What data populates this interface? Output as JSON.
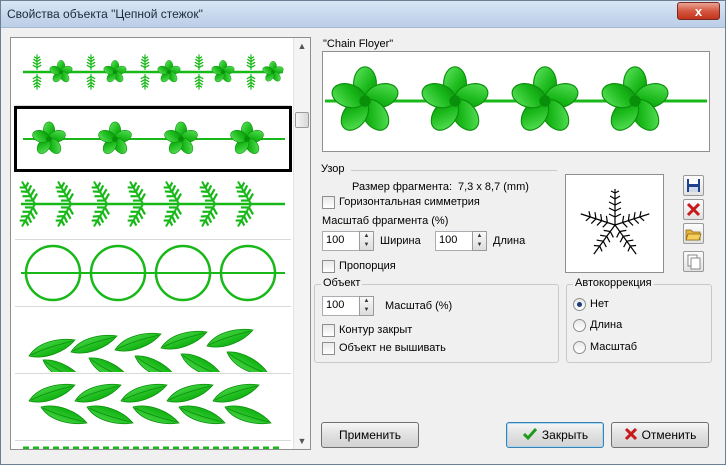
{
  "window": {
    "title": "Свойства объекта \"Цепной стежок\"",
    "close_label": "x"
  },
  "gallery": {
    "items": [
      "leaf-flower-chain",
      "flower-chain",
      "fern-chain",
      "ring-chain",
      "leaf-braid",
      "leaf-braid-2",
      "dots"
    ],
    "selected_index": 1
  },
  "preview": {
    "label": "\"Chain Floyer\""
  },
  "pattern": {
    "label": "Узор",
    "fragment_size_label": "Размер фрагмента:",
    "fragment_size_value": "7,3 x 8,7 (mm)",
    "h_symmetry_label": "Горизонтальная симметрия",
    "scale_label": "Масштаб фрагмента (%)",
    "width_value": "100",
    "width_label": "Ширина",
    "length_value": "100",
    "length_label": "Длина",
    "proportion_label": "Пропорция"
  },
  "object": {
    "label": "Объект",
    "scale_value": "100",
    "scale_label": "Масштаб (%)",
    "contour_closed_label": "Контур закрыт",
    "no_embroider_label": "Объект не вышивать"
  },
  "autocorrection": {
    "label": "Автокоррекция",
    "options": [
      "Нет",
      "Длина",
      "Масштаб"
    ],
    "selected": "Нет"
  },
  "buttons": {
    "apply": "Применить",
    "ok": "Закрыть",
    "cancel": "Отменить"
  },
  "colors": {
    "stitch_green": "#1fc21f",
    "stitch_dark": "#0a8f0a",
    "stitch_light": "#7ef07e",
    "accent_red": "#c8191a"
  }
}
